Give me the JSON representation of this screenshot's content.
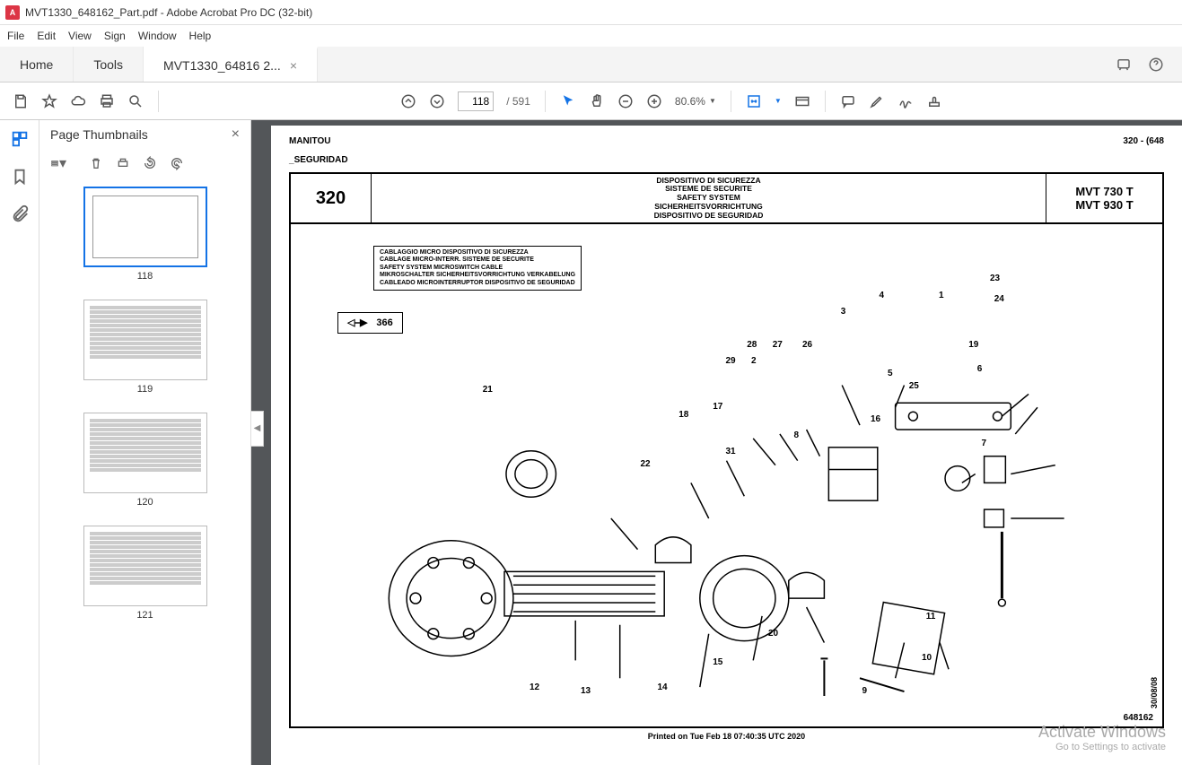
{
  "window": {
    "title": "MVT1330_648162_Part.pdf - Adobe Acrobat Pro DC (32-bit)",
    "icon_letter": "A"
  },
  "menu": {
    "file": "File",
    "edit": "Edit",
    "view": "View",
    "sign": "Sign",
    "window": "Window",
    "help": "Help"
  },
  "tabs": {
    "home": "Home",
    "tools": "Tools",
    "doc": "MVT1330_64816 2..."
  },
  "toolbar": {
    "page_current": "118",
    "page_total": "/ 591",
    "zoom": "80.6%"
  },
  "thumbs": {
    "title": "Page Thumbnails",
    "items": [
      {
        "label": "118",
        "active": true,
        "type": "schematic"
      },
      {
        "label": "119",
        "active": false,
        "type": "table"
      },
      {
        "label": "120",
        "active": false,
        "type": "table"
      },
      {
        "label": "121",
        "active": false,
        "type": "table"
      }
    ]
  },
  "doc": {
    "brand": "MANITOU",
    "page_ref": "320 - (648",
    "section": "SEGURIDAD",
    "diagram_number": "320",
    "titles": [
      "DISPOSITIVO DI SICUREZZA",
      "SISTEME DE SECURITE",
      "SAFETY SYSTEM",
      "SICHERHEITSVORRICHTUNG",
      "DISPOSITIVO DE SEGURIDAD"
    ],
    "models": [
      "MVT 730 T",
      "MVT 930 T"
    ],
    "info_lines": [
      "CABLAGGIO MICRO DISPOSITIVO DI SICUREZZA",
      "CABLAGE MICRO-INTERR. SISTEME DE SECURITE",
      "SAFETY SYSTEM MICROSWITCH CABLE",
      "MIKROSCHALTER SICHERHEITSVORRICHTUNG VERKABELUNG",
      "CABLEADO MICROINTERRUPTOR DISPOSITIVO DE SEGURIDAD"
    ],
    "ref_arrow": "◁⎯▶",
    "ref_num": "366",
    "date": "30/08/08",
    "docnum": "648162",
    "callouts": [
      "1",
      "2",
      "3",
      "4",
      "5",
      "6",
      "7",
      "8",
      "9",
      "10",
      "11",
      "12",
      "13",
      "14",
      "15",
      "16",
      "17",
      "18",
      "19",
      "20",
      "21",
      "22",
      "23",
      "24",
      "25",
      "26",
      "27",
      "28",
      "29",
      "31"
    ],
    "footer": "Printed on  Tue Feb 18 07:40:35 UTC 2020"
  },
  "watermark": {
    "line1": "Activate Windows",
    "line2": "Go to Settings to activate"
  }
}
